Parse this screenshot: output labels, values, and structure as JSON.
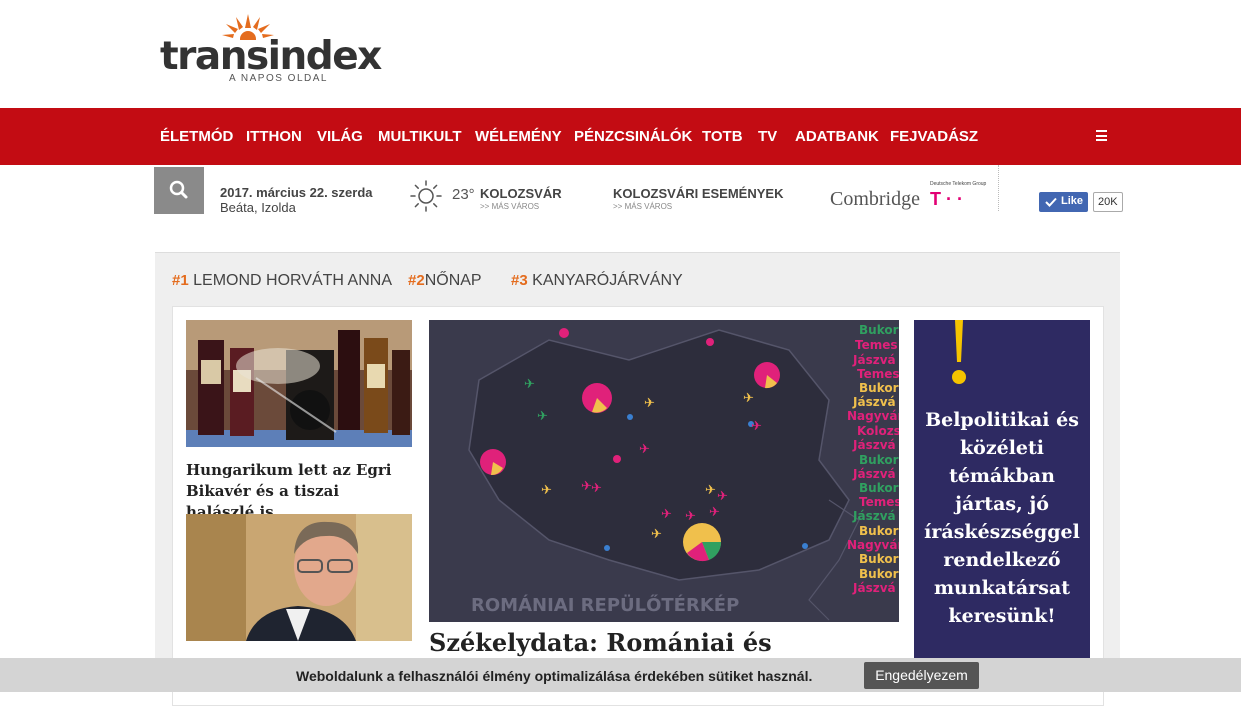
{
  "site": {
    "name": "transindex",
    "tagline": "A NAPOS OLDAL",
    "brand_color": "#c30c13",
    "accent_color": "#e46c1e"
  },
  "nav": {
    "items": [
      "ÉLETMÓD",
      "ITTHON",
      "VILÁG",
      "MULTIKULT",
      "WÉLEMÉNY",
      "PÉNZCSINÁLÓK",
      "TOTB",
      "TV",
      "ADATBANK",
      "FEJVADÁSZ"
    ],
    "menu_icon": "hamburger-icon"
  },
  "infobar": {
    "search_icon": "search-icon",
    "date": "2017. március 22. szerda",
    "namedays": "Beáta, Izolda",
    "weather": {
      "icon": "sun-icon",
      "temp": "23°",
      "city": "KOLOZSVÁR",
      "more": ">> MÁS VÁROS"
    },
    "events": {
      "title": "KOLOZSVÁRI ESEMÉNYEK",
      "more": ">> MÁS VÁROS"
    },
    "sponsor": {
      "name": "Combridge",
      "partner_label": "Deutsche Telekom Group",
      "partner_logo": "T · ·"
    },
    "facebook": {
      "like_label": "Like",
      "count": "20K"
    }
  },
  "trending": [
    {
      "rank": "#1",
      "label": "LEMOND HORVÁTH ANNA"
    },
    {
      "rank": "#2",
      "label": "NŐNAP"
    },
    {
      "rank": "#3",
      "label": "KANYARÓJÁRVÁNY"
    }
  ],
  "articles": {
    "left": [
      {
        "title": "Hungarikum lett az Egri Bikavér és a tiszai halászlé is",
        "image": "wine-bottles-photo"
      },
      {
        "title": "",
        "image": "portrait-photo"
      }
    ],
    "featured": {
      "title": "Székelydata: Romániai és",
      "image": "romania-flight-map",
      "map_caption": "ROMÁNIAI REPÜLŐTÉRKÉP",
      "city_labels": [
        "Bukor",
        "Temes",
        "Jászvá",
        "Temes",
        "Bukor",
        "Jászvá",
        "Nagyvár",
        "Kolozs",
        "Jászvá",
        "Bukor",
        "Jászvá",
        "Bukor",
        "Temes",
        "Jászvá",
        "Bukor",
        "Nagyvár",
        "Bukor",
        "Bukor",
        "Jászvá"
      ]
    }
  },
  "ad": {
    "text": "Belpolitikai és közéleti témákban jártas, jó íráskészséggel rendelkező munkatársat keresünk!",
    "background": "#2e2a62",
    "accent": "#f5c400"
  },
  "cookie": {
    "text": "Weboldalunk a felhasználói élmény optimalizálása érdekében sütiket használ.",
    "button": "Engedélyezem"
  }
}
